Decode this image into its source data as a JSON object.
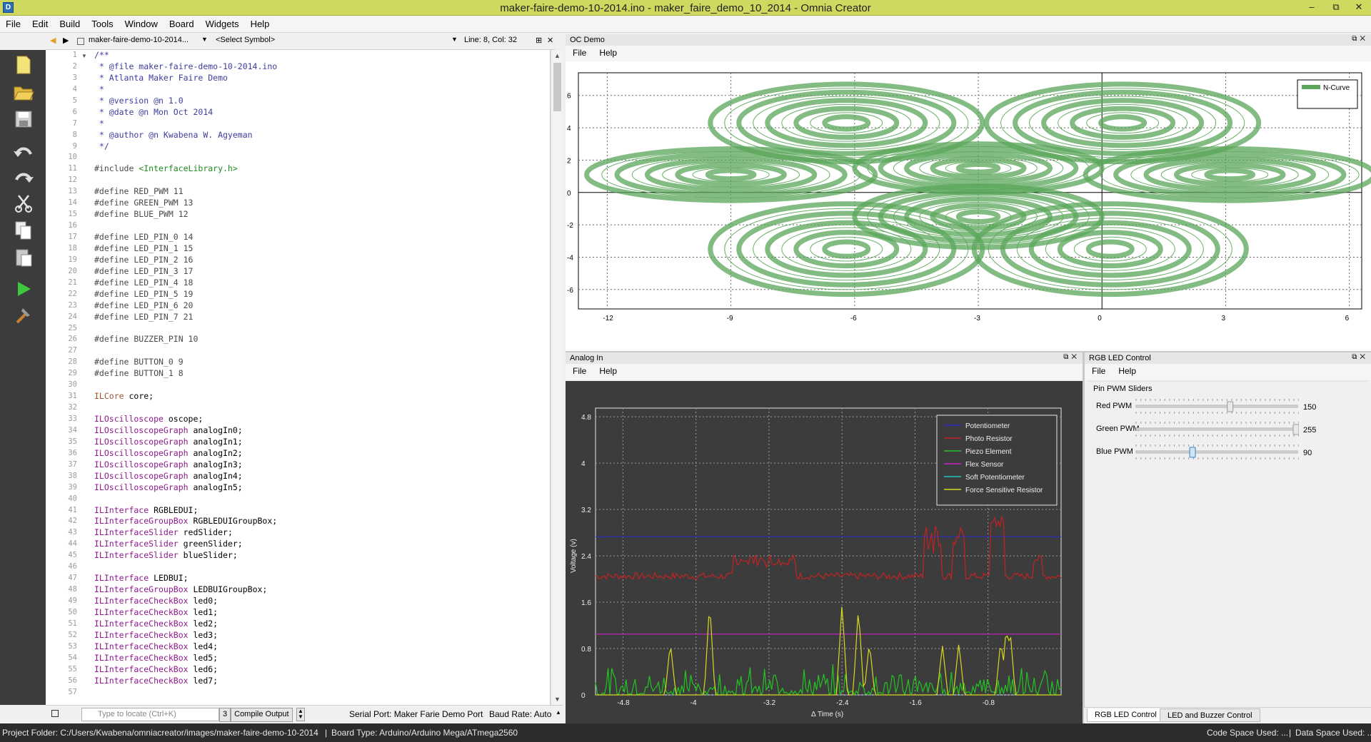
{
  "window": {
    "title": "maker-faire-demo-10-2014.ino - maker_faire_demo_10_2014 - Omnia Creator",
    "icon": "D"
  },
  "menu": [
    "File",
    "Edit",
    "Build",
    "Tools",
    "Window",
    "Board",
    "Widgets",
    "Help"
  ],
  "editor_header": {
    "file": "maker-faire-demo-10-2014...",
    "symbol": "<Select Symbol>",
    "position": "Line: 8, Col: 32"
  },
  "code_lines": [
    {
      "n": "1",
      "t": "/**",
      "c": "com"
    },
    {
      "n": "2",
      "t": " * @file maker-faire-demo-10-2014.ino",
      "c": "com"
    },
    {
      "n": "3",
      "t": " * Atlanta Maker Faire Demo",
      "c": "com"
    },
    {
      "n": "4",
      "t": " *",
      "c": "com"
    },
    {
      "n": "5",
      "t": " * @version @n 1.0",
      "c": "com"
    },
    {
      "n": "6",
      "t": " * @date @n Mon Oct 2014",
      "c": "com"
    },
    {
      "n": "7",
      "t": " *",
      "c": "com"
    },
    {
      "n": "8",
      "t": " * @author @n Kwabena W. Agyeman",
      "c": "com"
    },
    {
      "n": "9",
      "t": " */",
      "c": "com"
    },
    {
      "n": "10",
      "t": "",
      "c": ""
    },
    {
      "n": "11",
      "t": "#include ",
      "c": "pp",
      "s": "<InterfaceLibrary.h>",
      "sc": "str"
    },
    {
      "n": "12",
      "t": "",
      "c": ""
    },
    {
      "n": "13",
      "t": "#define RED_PWM 11",
      "c": "pp"
    },
    {
      "n": "14",
      "t": "#define GREEN_PWM 13",
      "c": "pp"
    },
    {
      "n": "15",
      "t": "#define BLUE_PWM 12",
      "c": "pp"
    },
    {
      "n": "16",
      "t": "",
      "c": ""
    },
    {
      "n": "17",
      "t": "#define LED_PIN_0 14",
      "c": "pp"
    },
    {
      "n": "18",
      "t": "#define LED_PIN_1 15",
      "c": "pp"
    },
    {
      "n": "19",
      "t": "#define LED_PIN_2 16",
      "c": "pp"
    },
    {
      "n": "20",
      "t": "#define LED_PIN_3 17",
      "c": "pp"
    },
    {
      "n": "21",
      "t": "#define LED_PIN_4 18",
      "c": "pp"
    },
    {
      "n": "22",
      "t": "#define LED_PIN_5 19",
      "c": "pp"
    },
    {
      "n": "23",
      "t": "#define LED_PIN_6 20",
      "c": "pp"
    },
    {
      "n": "24",
      "t": "#define LED_PIN_7 21",
      "c": "pp"
    },
    {
      "n": "25",
      "t": "",
      "c": ""
    },
    {
      "n": "26",
      "t": "#define BUZZER_PIN 10",
      "c": "pp"
    },
    {
      "n": "27",
      "t": "",
      "c": ""
    },
    {
      "n": "28",
      "t": "#define BUTTON_0 9",
      "c": "pp"
    },
    {
      "n": "29",
      "t": "#define BUTTON_1 8",
      "c": "pp"
    },
    {
      "n": "30",
      "t": "",
      "c": ""
    },
    {
      "n": "31",
      "t": "ILCore",
      "c": "lib",
      "s": " core;",
      "sc": ""
    },
    {
      "n": "32",
      "t": "",
      "c": ""
    },
    {
      "n": "33",
      "t": "ILOscilloscope",
      "c": "typ",
      "s": " oscope;",
      "sc": ""
    },
    {
      "n": "34",
      "t": "ILOscilloscopeGraph",
      "c": "typ",
      "s": " analogIn0;",
      "sc": ""
    },
    {
      "n": "35",
      "t": "ILOscilloscopeGraph",
      "c": "typ",
      "s": " analogIn1;",
      "sc": ""
    },
    {
      "n": "36",
      "t": "ILOscilloscopeGraph",
      "c": "typ",
      "s": " analogIn2;",
      "sc": ""
    },
    {
      "n": "37",
      "t": "ILOscilloscopeGraph",
      "c": "typ",
      "s": " analogIn3;",
      "sc": ""
    },
    {
      "n": "38",
      "t": "ILOscilloscopeGraph",
      "c": "typ",
      "s": " analogIn4;",
      "sc": ""
    },
    {
      "n": "39",
      "t": "ILOscilloscopeGraph",
      "c": "typ",
      "s": " analogIn5;",
      "sc": ""
    },
    {
      "n": "40",
      "t": "",
      "c": ""
    },
    {
      "n": "41",
      "t": "ILInterface",
      "c": "typ",
      "s": " RGBLEDUI;",
      "sc": ""
    },
    {
      "n": "42",
      "t": "ILInterfaceGroupBox",
      "c": "typ",
      "s": " RGBLEDUIGroupBox;",
      "sc": ""
    },
    {
      "n": "43",
      "t": "ILInterfaceSlider",
      "c": "typ",
      "s": " redSlider;",
      "sc": ""
    },
    {
      "n": "44",
      "t": "ILInterfaceSlider",
      "c": "typ",
      "s": " greenSlider;",
      "sc": ""
    },
    {
      "n": "45",
      "t": "ILInterfaceSlider",
      "c": "typ",
      "s": " blueSlider;",
      "sc": ""
    },
    {
      "n": "46",
      "t": "",
      "c": ""
    },
    {
      "n": "47",
      "t": "ILInterface",
      "c": "typ",
      "s": " LEDBUI;",
      "sc": ""
    },
    {
      "n": "48",
      "t": "ILInterfaceGroupBox",
      "c": "typ",
      "s": " LEDBUIGroupBox;",
      "sc": ""
    },
    {
      "n": "49",
      "t": "ILInterfaceCheckBox",
      "c": "typ",
      "s": " led0;",
      "sc": ""
    },
    {
      "n": "50",
      "t": "ILInterfaceCheckBox",
      "c": "typ",
      "s": " led1;",
      "sc": ""
    },
    {
      "n": "51",
      "t": "ILInterfaceCheckBox",
      "c": "typ",
      "s": " led2;",
      "sc": ""
    },
    {
      "n": "52",
      "t": "ILInterfaceCheckBox",
      "c": "typ",
      "s": " led3;",
      "sc": ""
    },
    {
      "n": "53",
      "t": "ILInterfaceCheckBox",
      "c": "typ",
      "s": " led4;",
      "sc": ""
    },
    {
      "n": "54",
      "t": "ILInterfaceCheckBox",
      "c": "typ",
      "s": " led5;",
      "sc": ""
    },
    {
      "n": "55",
      "t": "ILInterfaceCheckBox",
      "c": "typ",
      "s": " led6;",
      "sc": ""
    },
    {
      "n": "56",
      "t": "ILInterfaceCheckBox",
      "c": "typ",
      "s": " led7;",
      "sc": ""
    },
    {
      "n": "57",
      "t": "",
      "c": ""
    }
  ],
  "editor_footer": {
    "locate_placeholder": "Type to locate (Ctrl+K)",
    "output_count": "3",
    "output_label": "Compile Output",
    "serial_port": "Serial Port:  Maker Farie Demo Port",
    "baud": "Baud Rate:  Auto"
  },
  "status": {
    "folder": "Project Folder:  C:/Users/Kwabena/omniacreator/images/maker-faire-demo-10-2014",
    "sep": "|",
    "board": "Board Type:  Arduino/Arduino Mega/ATmega2560",
    "code_space": "Code Space Used:  ...",
    "data_space": "Data Space Used:  ..."
  },
  "oc_demo": {
    "title": "OC Demo",
    "menu": [
      "File",
      "Help"
    ],
    "chart_data": {
      "type": "line",
      "series": [
        {
          "name": "N-Curve",
          "color": "#5aa55a"
        }
      ],
      "xticks": [
        "-12",
        "-9",
        "-6",
        "-3",
        "0",
        "3",
        "6"
      ],
      "yticks": [
        "6",
        "4",
        "2",
        "0",
        "-2",
        "-4",
        "-6"
      ],
      "xlim": [
        -12.7,
        6.3
      ],
      "ylim": [
        -7.2,
        7.4
      ],
      "grid": true,
      "legend": "top-right",
      "curve": "rose-like parametric band, x range about -12.5 to 6.3, y range about -7 to 7"
    }
  },
  "analog_in": {
    "title": "Analog In",
    "menu": [
      "File",
      "Help"
    ],
    "chart_data": {
      "type": "line",
      "xlabel": "Δ Time (s)",
      "ylabel": "Voltage (v)",
      "xticks": [
        "-4.8",
        "-4",
        "-3.2",
        "-2.4",
        "-1.6",
        "-0.8"
      ],
      "yticks": [
        "4.8",
        "4",
        "3.2",
        "2.4",
        "1.6",
        "0.8",
        "0"
      ],
      "xlim": [
        -5.1,
        0
      ],
      "ylim": [
        0,
        4.95
      ],
      "grid": true,
      "legend": "top-right",
      "series": [
        {
          "name": "Potentiometer",
          "color": "#2a2ac8",
          "values_desc": "constant about 2.73 V"
        },
        {
          "name": "Photo Resistor",
          "color": "#c42222",
          "values_desc": "noisy around 2.0-2.2 V, peaks near 3.1 V at -0.7 s"
        },
        {
          "name": "Piezo Element",
          "color": "#22c422",
          "values_desc": "noise 0.0-0.5 V"
        },
        {
          "name": "Flex Sensor",
          "color": "#c422c4",
          "values_desc": "constant about 1.05 V"
        },
        {
          "name": "Soft Potentiometer",
          "color": "#22c4c4",
          "values_desc": "not visible (0 V)"
        },
        {
          "name": "Force Sensitive Resistor",
          "color": "#d8d822",
          "values_desc": "spikes to 1.6 V at -3.85 s and -2.4 s, 1.2 V at -0.6 s"
        }
      ]
    }
  },
  "rgb": {
    "title": "RGB LED Control",
    "menu": [
      "File",
      "Help"
    ],
    "group": "Pin PWM Sliders",
    "sliders": [
      {
        "label": "Red PWM",
        "value": "150",
        "fraction": 0.588
      },
      {
        "label": "Green PWM",
        "value": "255",
        "fraction": 1.0
      },
      {
        "label": "Blue PWM",
        "value": "90",
        "fraction": 0.353
      }
    ],
    "tabs": [
      "RGB LED Control",
      "LED and Buzzer Control"
    ]
  }
}
